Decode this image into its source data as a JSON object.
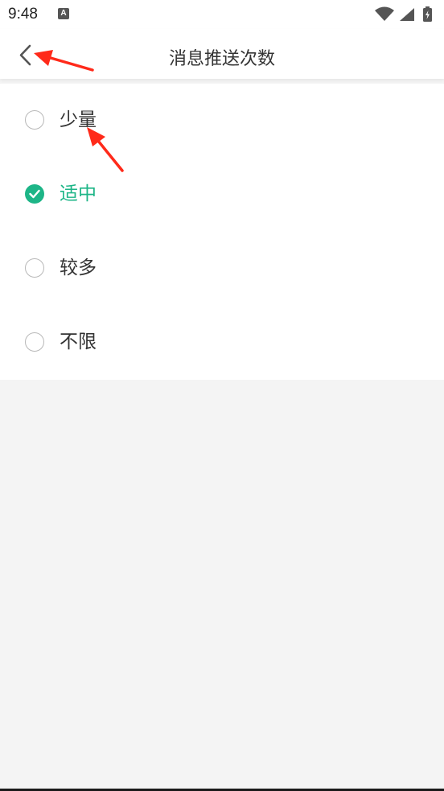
{
  "status_bar": {
    "time": "9:48",
    "app_icon_letter": "A",
    "icons": [
      "wifi-icon",
      "signal-icon",
      "battery-charging-icon"
    ]
  },
  "header": {
    "title": "消息推送次数",
    "back_icon": "chevron-left-icon"
  },
  "options": [
    {
      "label": "少量",
      "selected": false
    },
    {
      "label": "适中",
      "selected": true
    },
    {
      "label": "较多",
      "selected": false
    },
    {
      "label": "不限",
      "selected": false
    }
  ],
  "colors": {
    "accent": "#1db587",
    "annotation_arrow": "#ff2a1a",
    "background": "#f4f4f4"
  }
}
